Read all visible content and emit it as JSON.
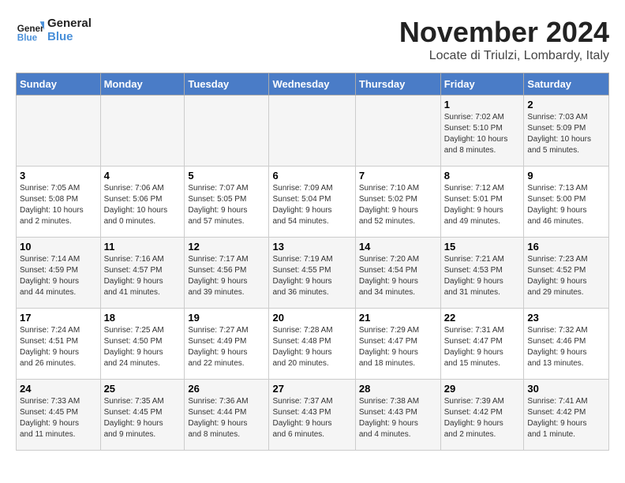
{
  "logo": {
    "line1": "General",
    "line2": "Blue"
  },
  "title": "November 2024",
  "subtitle": "Locate di Triulzi, Lombardy, Italy",
  "weekdays": [
    "Sunday",
    "Monday",
    "Tuesday",
    "Wednesday",
    "Thursday",
    "Friday",
    "Saturday"
  ],
  "weeks": [
    [
      {
        "day": "",
        "info": ""
      },
      {
        "day": "",
        "info": ""
      },
      {
        "day": "",
        "info": ""
      },
      {
        "day": "",
        "info": ""
      },
      {
        "day": "",
        "info": ""
      },
      {
        "day": "1",
        "info": "Sunrise: 7:02 AM\nSunset: 5:10 PM\nDaylight: 10 hours\nand 8 minutes."
      },
      {
        "day": "2",
        "info": "Sunrise: 7:03 AM\nSunset: 5:09 PM\nDaylight: 10 hours\nand 5 minutes."
      }
    ],
    [
      {
        "day": "3",
        "info": "Sunrise: 7:05 AM\nSunset: 5:08 PM\nDaylight: 10 hours\nand 2 minutes."
      },
      {
        "day": "4",
        "info": "Sunrise: 7:06 AM\nSunset: 5:06 PM\nDaylight: 10 hours\nand 0 minutes."
      },
      {
        "day": "5",
        "info": "Sunrise: 7:07 AM\nSunset: 5:05 PM\nDaylight: 9 hours\nand 57 minutes."
      },
      {
        "day": "6",
        "info": "Sunrise: 7:09 AM\nSunset: 5:04 PM\nDaylight: 9 hours\nand 54 minutes."
      },
      {
        "day": "7",
        "info": "Sunrise: 7:10 AM\nSunset: 5:02 PM\nDaylight: 9 hours\nand 52 minutes."
      },
      {
        "day": "8",
        "info": "Sunrise: 7:12 AM\nSunset: 5:01 PM\nDaylight: 9 hours\nand 49 minutes."
      },
      {
        "day": "9",
        "info": "Sunrise: 7:13 AM\nSunset: 5:00 PM\nDaylight: 9 hours\nand 46 minutes."
      }
    ],
    [
      {
        "day": "10",
        "info": "Sunrise: 7:14 AM\nSunset: 4:59 PM\nDaylight: 9 hours\nand 44 minutes."
      },
      {
        "day": "11",
        "info": "Sunrise: 7:16 AM\nSunset: 4:57 PM\nDaylight: 9 hours\nand 41 minutes."
      },
      {
        "day": "12",
        "info": "Sunrise: 7:17 AM\nSunset: 4:56 PM\nDaylight: 9 hours\nand 39 minutes."
      },
      {
        "day": "13",
        "info": "Sunrise: 7:19 AM\nSunset: 4:55 PM\nDaylight: 9 hours\nand 36 minutes."
      },
      {
        "day": "14",
        "info": "Sunrise: 7:20 AM\nSunset: 4:54 PM\nDaylight: 9 hours\nand 34 minutes."
      },
      {
        "day": "15",
        "info": "Sunrise: 7:21 AM\nSunset: 4:53 PM\nDaylight: 9 hours\nand 31 minutes."
      },
      {
        "day": "16",
        "info": "Sunrise: 7:23 AM\nSunset: 4:52 PM\nDaylight: 9 hours\nand 29 minutes."
      }
    ],
    [
      {
        "day": "17",
        "info": "Sunrise: 7:24 AM\nSunset: 4:51 PM\nDaylight: 9 hours\nand 26 minutes."
      },
      {
        "day": "18",
        "info": "Sunrise: 7:25 AM\nSunset: 4:50 PM\nDaylight: 9 hours\nand 24 minutes."
      },
      {
        "day": "19",
        "info": "Sunrise: 7:27 AM\nSunset: 4:49 PM\nDaylight: 9 hours\nand 22 minutes."
      },
      {
        "day": "20",
        "info": "Sunrise: 7:28 AM\nSunset: 4:48 PM\nDaylight: 9 hours\nand 20 minutes."
      },
      {
        "day": "21",
        "info": "Sunrise: 7:29 AM\nSunset: 4:47 PM\nDaylight: 9 hours\nand 18 minutes."
      },
      {
        "day": "22",
        "info": "Sunrise: 7:31 AM\nSunset: 4:47 PM\nDaylight: 9 hours\nand 15 minutes."
      },
      {
        "day": "23",
        "info": "Sunrise: 7:32 AM\nSunset: 4:46 PM\nDaylight: 9 hours\nand 13 minutes."
      }
    ],
    [
      {
        "day": "24",
        "info": "Sunrise: 7:33 AM\nSunset: 4:45 PM\nDaylight: 9 hours\nand 11 minutes."
      },
      {
        "day": "25",
        "info": "Sunrise: 7:35 AM\nSunset: 4:45 PM\nDaylight: 9 hours\nand 9 minutes."
      },
      {
        "day": "26",
        "info": "Sunrise: 7:36 AM\nSunset: 4:44 PM\nDaylight: 9 hours\nand 8 minutes."
      },
      {
        "day": "27",
        "info": "Sunrise: 7:37 AM\nSunset: 4:43 PM\nDaylight: 9 hours\nand 6 minutes."
      },
      {
        "day": "28",
        "info": "Sunrise: 7:38 AM\nSunset: 4:43 PM\nDaylight: 9 hours\nand 4 minutes."
      },
      {
        "day": "29",
        "info": "Sunrise: 7:39 AM\nSunset: 4:42 PM\nDaylight: 9 hours\nand 2 minutes."
      },
      {
        "day": "30",
        "info": "Sunrise: 7:41 AM\nSunset: 4:42 PM\nDaylight: 9 hours\nand 1 minute."
      }
    ]
  ]
}
